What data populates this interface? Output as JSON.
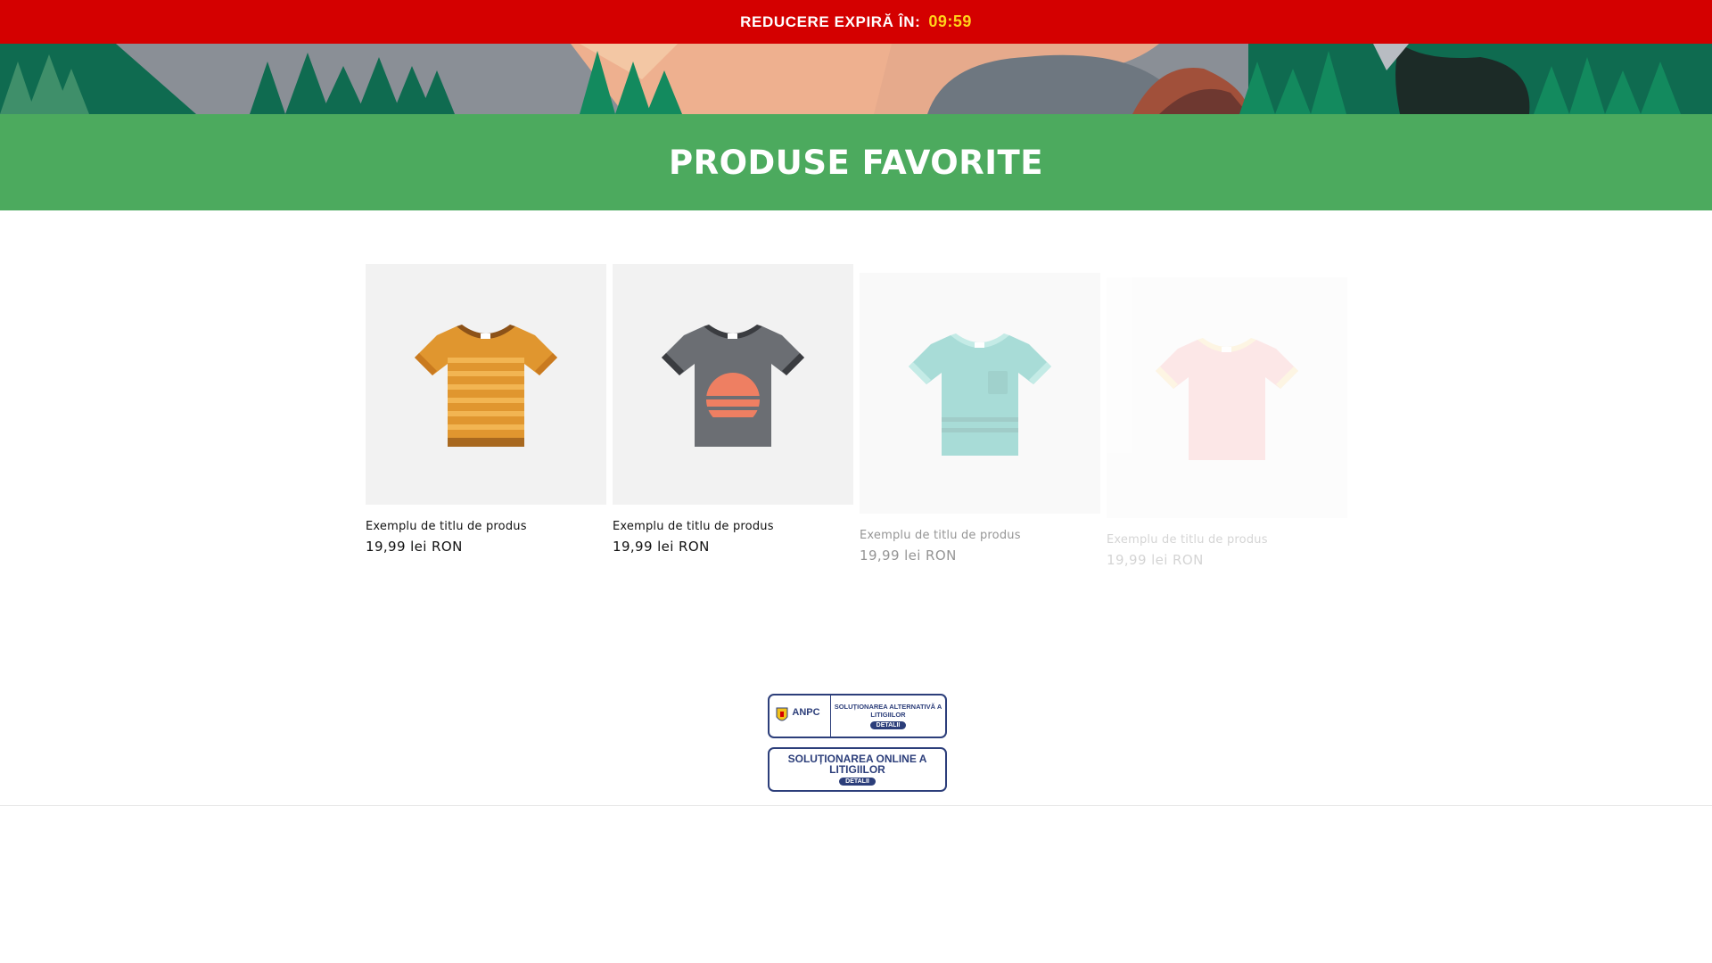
{
  "announcement": {
    "label": "REDUCERE EXPIRĂ ÎN:",
    "timer": "09:59"
  },
  "collection": {
    "heading": "PRODUSE FAVORITE"
  },
  "products": [
    {
      "title": "Exemplu de titlu de produs",
      "price": "19,99 lei RON",
      "icon": "tshirt-orange-striped"
    },
    {
      "title": "Exemplu de titlu de produs",
      "price": "19,99 lei RON",
      "icon": "tshirt-grey-sunset"
    },
    {
      "title": "Exemplu de titlu de produs",
      "price": "19,99 lei RON",
      "icon": "tshirt-teal-pocket"
    },
    {
      "title": "Exemplu de titlu de produs",
      "price": "19,99 lei RON",
      "icon": "tshirt-pink"
    }
  ],
  "badges": {
    "anpc": {
      "logo_text": "ANPC",
      "text": "SOLUȚIONAREA ALTERNATIVĂ A LITIGIILOR",
      "button": "DETALII"
    },
    "sol": {
      "text": "SOLUȚIONAREA ONLINE A LITIGIILOR",
      "button": "DETALII"
    }
  },
  "colors": {
    "announcement_bg": "#d40000",
    "timer": "#ffd21a",
    "heading_bg": "#4caa5e",
    "badge": "#2c3e7a"
  }
}
